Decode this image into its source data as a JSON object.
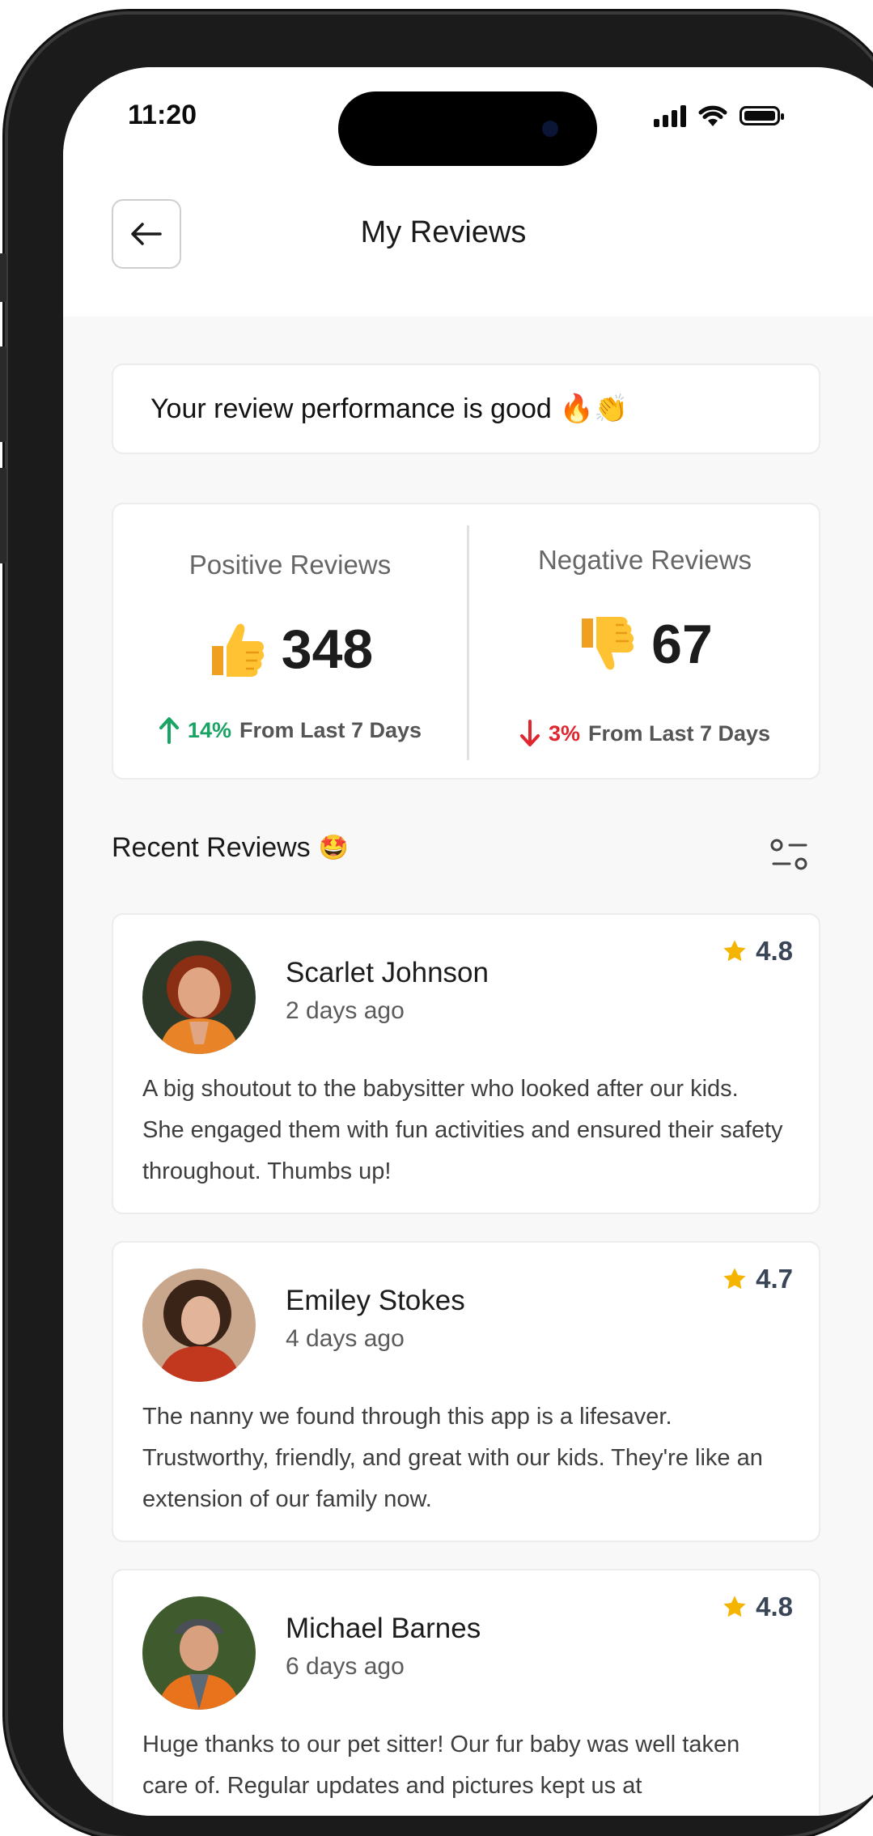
{
  "status_bar": {
    "time": "11:20"
  },
  "header": {
    "title": "My Reviews"
  },
  "performance": {
    "text": "Your review performance is good",
    "emoji": "🔥👏"
  },
  "stats": {
    "positive": {
      "label": "Positive Reviews",
      "count": "348",
      "percent": "14%",
      "trend_text": "From Last 7 Days",
      "direction": "up",
      "icon": "thumbs-up"
    },
    "negative": {
      "label": "Negative Reviews",
      "count": "67",
      "percent": "3%",
      "trend_text": "From Last 7 Days",
      "direction": "down",
      "icon": "thumbs-down"
    }
  },
  "recent": {
    "title": "Recent Reviews",
    "emoji": "🤩",
    "reviews": [
      {
        "name": "Scarlet Johnson",
        "time": "2 days ago",
        "rating": "4.8",
        "text": "A big shoutout to the babysitter who looked after our kids. She engaged them with fun activities and ensured their safety throughout. Thumbs up!"
      },
      {
        "name": "Emiley Stokes",
        "time": "4 days ago",
        "rating": "4.7",
        "text": "The nanny we found through this app is a lifesaver. Trustworthy, friendly, and great with our kids. They're like an extension of our family now."
      },
      {
        "name": "Michael Barnes",
        "time": "6 days ago",
        "rating": "4.8",
        "text": "Huge thanks to our pet sitter! Our fur baby was well taken care of. Regular updates and pictures kept us at"
      }
    ]
  },
  "colors": {
    "positive": "#1aa463",
    "negative": "#e0262e",
    "star": "#f5b400",
    "rating_text": "#3a4658"
  }
}
